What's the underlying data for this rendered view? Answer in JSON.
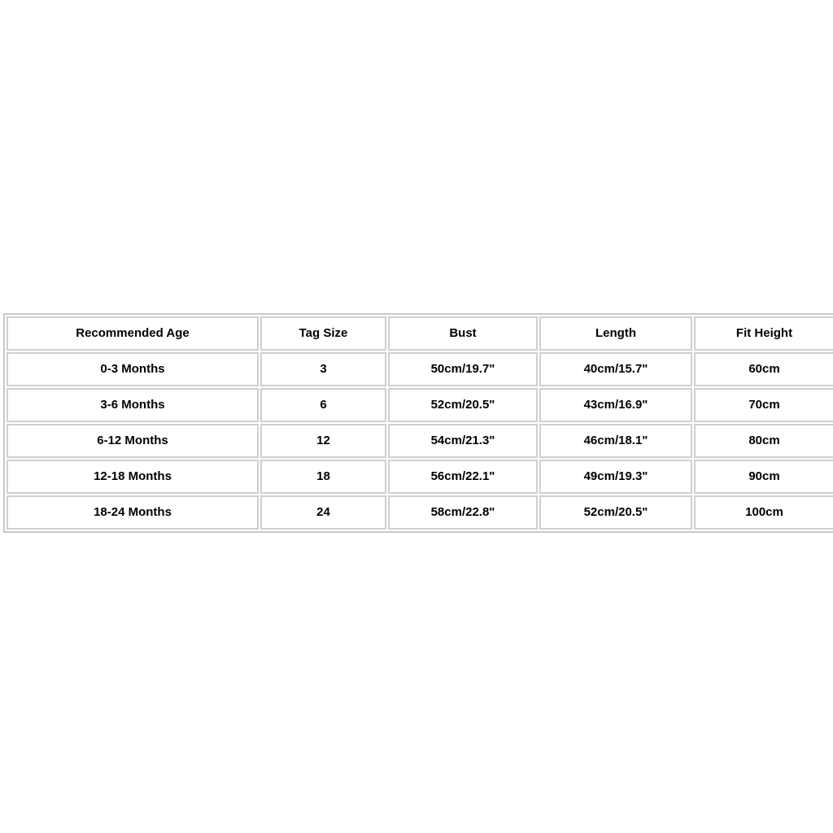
{
  "page": {
    "background_color": "#ffffff",
    "text_color": "#000000",
    "border_color": "#cfcfcf",
    "outer_border_color": "#c9c9c9"
  },
  "size_chart": {
    "columns": [
      "Recommended Age",
      "Tag Size",
      "Bust",
      "Length",
      "Fit Height"
    ],
    "rows": [
      {
        "age": "0-3 Months",
        "tag_size": "3",
        "bust": "50cm/19.7\"",
        "length": "40cm/15.7\"",
        "fit_height": "60cm"
      },
      {
        "age": "3-6 Months",
        "tag_size": "6",
        "bust": "52cm/20.5\"",
        "length": "43cm/16.9\"",
        "fit_height": "70cm"
      },
      {
        "age": "6-12 Months",
        "tag_size": "12",
        "bust": "54cm/21.3\"",
        "length": "46cm/18.1\"",
        "fit_height": "80cm"
      },
      {
        "age": "12-18 Months",
        "tag_size": "18",
        "bust": "56cm/22.1\"",
        "length": "49cm/19.3\"",
        "fit_height": "90cm"
      },
      {
        "age": "18-24 Months",
        "tag_size": "24",
        "bust": "58cm/22.8\"",
        "length": "52cm/20.5\"",
        "fit_height": "100cm"
      }
    ]
  }
}
